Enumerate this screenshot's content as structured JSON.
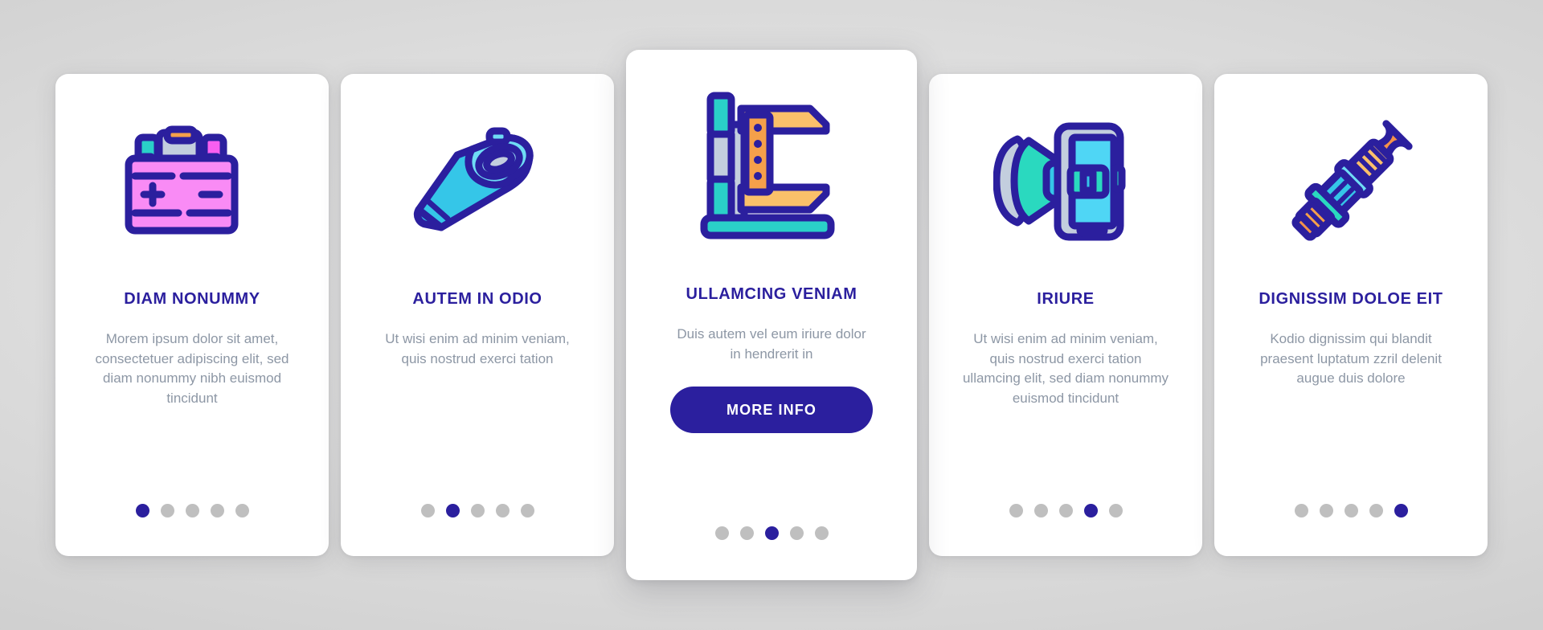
{
  "theme": {
    "accent": "#2b1f9e",
    "title_color": "#2b1f9e",
    "body_text_color": "#8d97a5",
    "card_bg": "#ffffff",
    "dot_inactive": "#bfbfbf",
    "dot_active": "#2b1f9e",
    "background": "#d8d8d8"
  },
  "cards": [
    {
      "icon": "car-battery-icon",
      "title": "DIAM NONUMMY",
      "description": "Morem ipsum dolor sit amet, consectetuer adipiscing elit, sed diam nonummy nibh euismod tincidunt",
      "dots": {
        "count": 5,
        "active_index": 0
      },
      "featured": false,
      "button": null
    },
    {
      "icon": "muffler-exhaust-icon",
      "title": "AUTEM IN ODIO",
      "description": "Ut wisi enim ad minim veniam, quis nostrud exerci tation",
      "dots": {
        "count": 5,
        "active_index": 1
      },
      "featured": false,
      "button": null
    },
    {
      "icon": "caliper-measuring-tool-icon",
      "title": "ULLAMCING VENIAM",
      "description": "Duis autem vel eum iriure dolor in hendrerit in",
      "dots": {
        "count": 5,
        "active_index": 2
      },
      "featured": true,
      "button": {
        "label": "MORE INFO"
      }
    },
    {
      "icon": "phone-car-holder-icon",
      "title": "IRIURE",
      "description": "Ut wisi enim ad minim veniam, quis nostrud exerci tation ullamcing elit, sed diam nonummy euismod tincidunt",
      "dots": {
        "count": 5,
        "active_index": 3
      },
      "featured": false,
      "button": null
    },
    {
      "icon": "spark-plug-icon",
      "title": "DIGNISSIM DOLOE EIT",
      "description": "Kodio dignissim qui blandit praesent luptatum zzril delenit augue duis dolore",
      "dots": {
        "count": 5,
        "active_index": 4
      },
      "featured": false,
      "button": null
    }
  ]
}
